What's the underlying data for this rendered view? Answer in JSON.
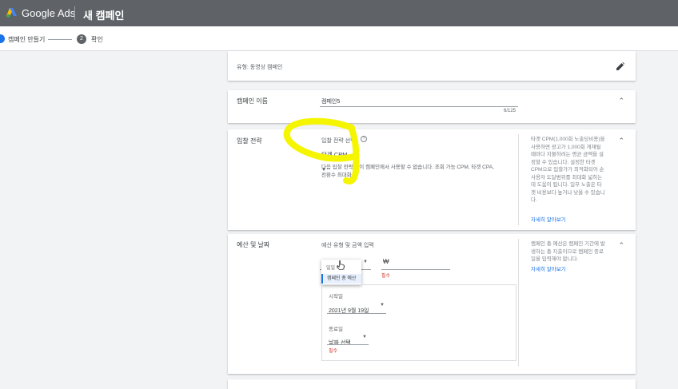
{
  "header": {
    "brand": "Google Ads",
    "title": "새 캠페인"
  },
  "steps": [
    {
      "label": "캠페인 만들기"
    },
    {
      "number": "2",
      "label": "확인"
    }
  ],
  "type_card": {
    "text": "유형: 동영상 캠페인"
  },
  "name_card": {
    "label": "캠페인 이름",
    "value": "캠페인5",
    "counter": "6/125"
  },
  "bidding_card": {
    "label": "입찰 전략",
    "field_label": "입찰 전략 선택",
    "selected": "타겟 CPM",
    "note_line1": "다음 입찰 전략은 이 캠페인에서 사용할 수 없습니다. 조회 가능 CPM, 타겟 CPA,",
    "note_line2": "전환수 최대화",
    "helper": [
      "타겟 CPM(1,000회 노출당비용)을",
      "사용하면 광고가 1,000회 게재될",
      "때마다 지불하려는 평균 금액을 설",
      "정할 수 있습니다. 설정한 타겟",
      "CPM으로 입찰가가 최적화되어 순",
      "사용자 도달범위를 최대화 넓히는",
      "데 도움이 됩니다. 일부 노출은 타",
      "겟 비용보다 높거나 낮을 수 있습니",
      "다."
    ],
    "helper_link": "자세히 알아보기"
  },
  "budget_card": {
    "label": "예산 및 날짜",
    "field_label": "예산 유형 및 금액 입력",
    "dropdown_options": [
      "일일 예산",
      "캠페인 총 예산"
    ],
    "currency": "₩",
    "required": "필수",
    "start_label": "시작일",
    "start_value": "2021년 9월 19일",
    "end_label": "종료일",
    "end_value": "날짜 선택",
    "end_required": "필수",
    "helper": [
      "캠페인 총 예산은 캠페인 기간에 발",
      "생하는 총 지출이므로 캠페인 종료",
      "일을 입력해야 합니다."
    ],
    "helper_link": "자세히 알아보기"
  },
  "colors": {
    "header_bg": "#5f6368",
    "accent": "#1a73e8",
    "highlight": "#f5f500",
    "required": "#d93025"
  }
}
